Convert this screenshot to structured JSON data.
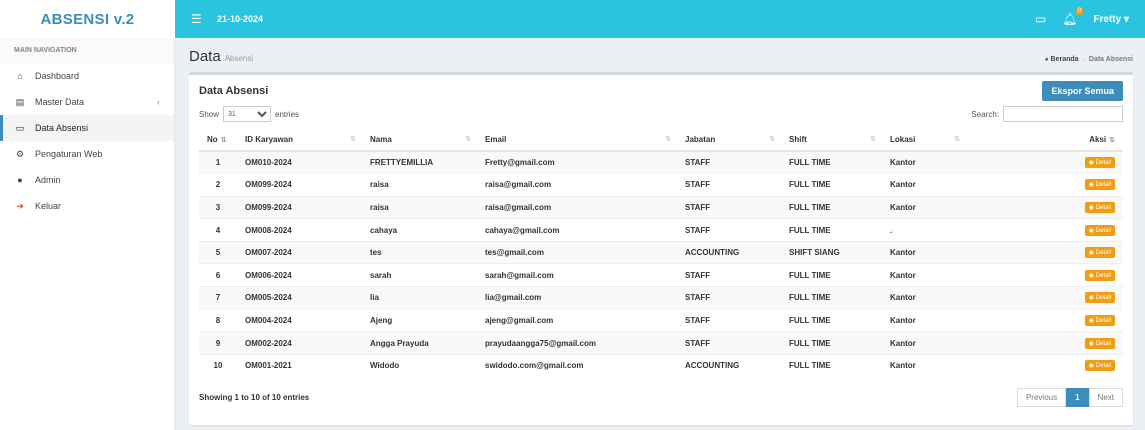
{
  "app": {
    "title": "ABSENSI v.2"
  },
  "topbar": {
    "date": "21-10-2024",
    "user": "Fretty",
    "user_caret": "▾",
    "notif_count": "0"
  },
  "sidebar": {
    "heading": "MAIN NAVIGATION",
    "items": [
      {
        "label": "Dashboard",
        "icon": "home-icon"
      },
      {
        "label": "Master Data",
        "icon": "database-icon"
      },
      {
        "label": "Data Absensi",
        "icon": "table-icon"
      },
      {
        "label": "Pengaturan Web",
        "icon": "cogs-icon"
      },
      {
        "label": "Admin",
        "icon": "user-icon"
      },
      {
        "label": "Keluar",
        "icon": "sign-out-icon"
      }
    ]
  },
  "page": {
    "title": "Data",
    "subtitle": "Absensi",
    "breadcrumb_home": "Beranda",
    "breadcrumb_current": "Data Absensi"
  },
  "box": {
    "title": "Data Absensi",
    "export_label": "Ekspor Semua"
  },
  "controls": {
    "show_label": "Show",
    "entries_label": "entries",
    "page_size": "31",
    "search_label": "Search:"
  },
  "table": {
    "headers": {
      "no": "No",
      "id": "ID Karyawan",
      "nama": "Nama",
      "email": "Email",
      "jabatan": "Jabatan",
      "shift": "Shift",
      "lokasi": "Lokasi",
      "aksi": "Aksi"
    },
    "detail_label": "Detail",
    "rows": [
      {
        "no": "1",
        "id": "OM010-2024",
        "nama": "FRETTYEMILLIA",
        "email": "Fretty@gmail.com",
        "jabatan": "STAFF",
        "shift": "FULL TIME",
        "lokasi": "Kantor"
      },
      {
        "no": "2",
        "id": "OM099-2024",
        "nama": "raisa",
        "email": "raisa@gmail.com",
        "jabatan": "STAFF",
        "shift": "FULL TIME",
        "lokasi": "Kantor"
      },
      {
        "no": "3",
        "id": "OM099-2024",
        "nama": "raisa",
        "email": "raisa@gmail.com",
        "jabatan": "STAFF",
        "shift": "FULL TIME",
        "lokasi": "Kantor"
      },
      {
        "no": "4",
        "id": "OM008-2024",
        "nama": "cahaya",
        "email": "cahaya@gmail.com",
        "jabatan": "STAFF",
        "shift": "FULL TIME",
        "lokasi": "."
      },
      {
        "no": "5",
        "id": "OM007-2024",
        "nama": "tes",
        "email": "tes@gmail.com",
        "jabatan": "ACCOUNTING",
        "shift": "SHIFT SIANG",
        "lokasi": "Kantor"
      },
      {
        "no": "6",
        "id": "OM006-2024",
        "nama": "sarah",
        "email": "sarah@gmail.com",
        "jabatan": "STAFF",
        "shift": "FULL TIME",
        "lokasi": "Kantor"
      },
      {
        "no": "7",
        "id": "OM005-2024",
        "nama": "lia",
        "email": "lia@gmail.com",
        "jabatan": "STAFF",
        "shift": "FULL TIME",
        "lokasi": "Kantor"
      },
      {
        "no": "8",
        "id": "OM004-2024",
        "nama": "Ajeng",
        "email": "ajeng@gmail.com",
        "jabatan": "STAFF",
        "shift": "FULL TIME",
        "lokasi": "Kantor"
      },
      {
        "no": "9",
        "id": "OM002-2024",
        "nama": "Angga Prayuda",
        "email": "prayudaangga75@gmail.com",
        "jabatan": "STAFF",
        "shift": "FULL TIME",
        "lokasi": "Kantor"
      },
      {
        "no": "10",
        "id": "OM001-2021",
        "nama": "Widodo",
        "email": "swidodo.com@gmail.com",
        "jabatan": "ACCOUNTING",
        "shift": "FULL TIME",
        "lokasi": "Kantor"
      }
    ]
  },
  "footer": {
    "info": "Showing 1 to 10 of 10 entries",
    "prev": "Previous",
    "page": "1",
    "next": "Next"
  },
  "colors": {
    "topbar": "#2bc4e0",
    "brand": "#3c8dbc",
    "detail": "#f39c12"
  }
}
